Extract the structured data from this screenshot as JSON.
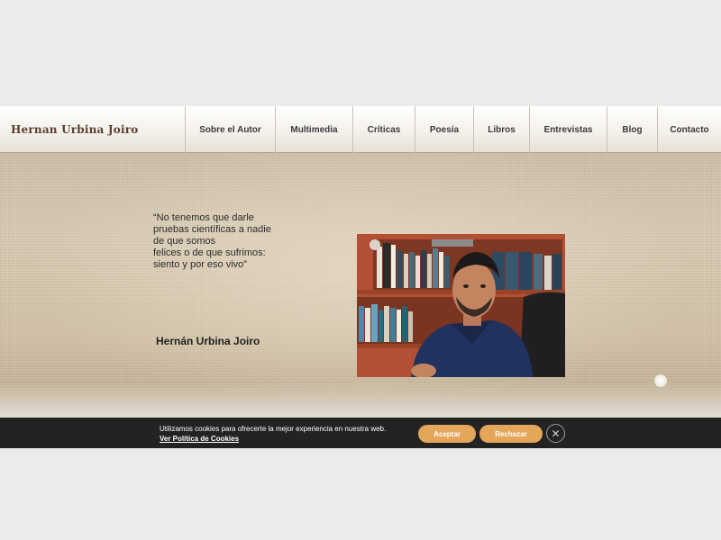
{
  "header": {
    "logo": "Hernan Urbina Joiro",
    "nav": [
      "Sobre el Autor",
      "Multimedia",
      "Críticas",
      "Poesía",
      "Libros",
      "Entrevistas",
      "Blog",
      "Contacto"
    ]
  },
  "hero": {
    "quote_lines": [
      "“No tenemos que darle",
      "pruebas científicas a nadie",
      "de que somos",
      "felices o de que sufrimos:",
      "siento y por eso vivo”"
    ],
    "author": "Hernán Urbina Joiro"
  },
  "cookie": {
    "message": "Utilizamos cookies para ofrecerte la mejor experiencia en nuestra web.",
    "link": "Ver Política de Cookies",
    "accept": "Aceptar",
    "reject": "Rechazar",
    "close_icon": "close-icon"
  },
  "colors": {
    "logo": "#5a3e2b",
    "button": "#e3a65a",
    "cookie_bar": "#232323"
  }
}
